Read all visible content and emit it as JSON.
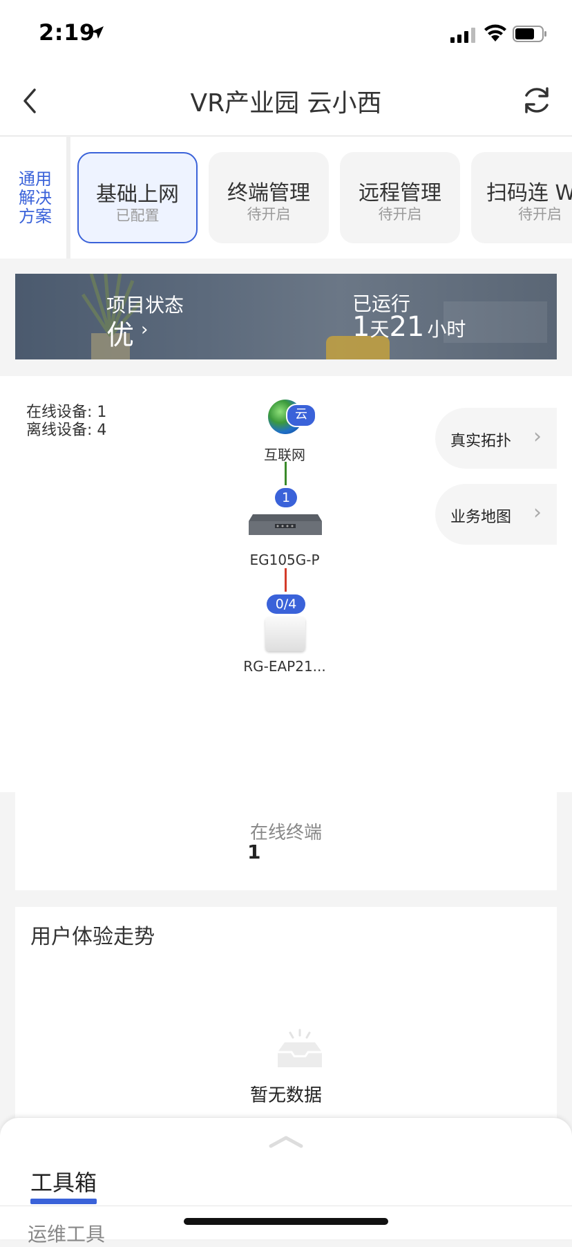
{
  "status_bar": {
    "time": "2:19"
  },
  "nav": {
    "title": "VR产业园 云小西"
  },
  "solutions": {
    "label_line1": "通用",
    "label_line2": "解决",
    "label_line3": "方案",
    "cards": [
      {
        "title": "基础上网",
        "status": "已配置"
      },
      {
        "title": "终端管理",
        "status": "待开启"
      },
      {
        "title": "远程管理",
        "status": "待开启"
      },
      {
        "title": "扫码连 W",
        "status": "待开启"
      }
    ]
  },
  "banner": {
    "project_status_label": "项目状态",
    "project_status_value": "优",
    "running_label": "已运行",
    "running_days": "1",
    "running_days_unit": "天",
    "running_hours": "21",
    "running_hours_unit": "小时"
  },
  "topology": {
    "online_devices": "在线设备: 1",
    "offline_devices": "离线设备: 4",
    "cloud_badge": "云",
    "internet_label": "互联网",
    "link1_badge": "1",
    "router_label": "EG105G-P",
    "link2_badge": "0/4",
    "ap_label": "RG-EAP21...",
    "real_topology_button": "真实拓扑",
    "business_map_button": "业务地图"
  },
  "online_terminals": {
    "label": "在线终端",
    "value": "1"
  },
  "ux_trend": {
    "title": "用户体验走势",
    "empty_text": "暂无数据"
  },
  "bottom_sheet": {
    "tab_toolbox": "工具箱",
    "ops_tools": "运维工具"
  },
  "colors": {
    "accent": "#3a62d9",
    "link_ok": "#3a8a2a",
    "link_bad": "#d43b2a"
  }
}
